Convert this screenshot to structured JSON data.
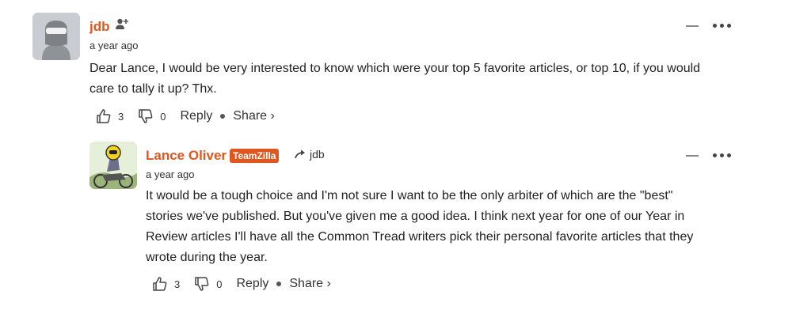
{
  "comments": [
    {
      "author": "jdb",
      "time": "a year ago",
      "lines": [
        "Dear Lance, I would be very interested to know which were your top 5 favorite articles, or top 10, if you would",
        "care to tally it up? Thx."
      ],
      "likes": "3",
      "dislikes": "0",
      "reply_label": "Reply",
      "share_label": "Share ›"
    },
    {
      "author": "Lance Oliver",
      "badge": "TeamZilla",
      "reply_to": "jdb",
      "time": "a year ago",
      "lines": [
        "It would be a tough choice and I'm not sure I want to be the only arbiter of which are the \"best\"",
        "stories we've published. But you've given me a good idea. I think next year for one of our Year in",
        "Review articles I'll have all the Common Tread writers pick their personal favorite articles that they",
        "wrote during the year."
      ],
      "likes": "3",
      "dislikes": "0",
      "reply_label": "Reply",
      "share_label": "Share ›"
    }
  ],
  "icons": {
    "follow": "person-plus-icon",
    "reply_arrow": "reply-arrow-icon",
    "like": "thumbs-up-icon",
    "dislike": "thumbs-down-icon",
    "minimize": "minimize-icon",
    "more": "more-options-icon"
  },
  "colors": {
    "author": "#e0561d",
    "badge_bg": "#e0561d"
  }
}
